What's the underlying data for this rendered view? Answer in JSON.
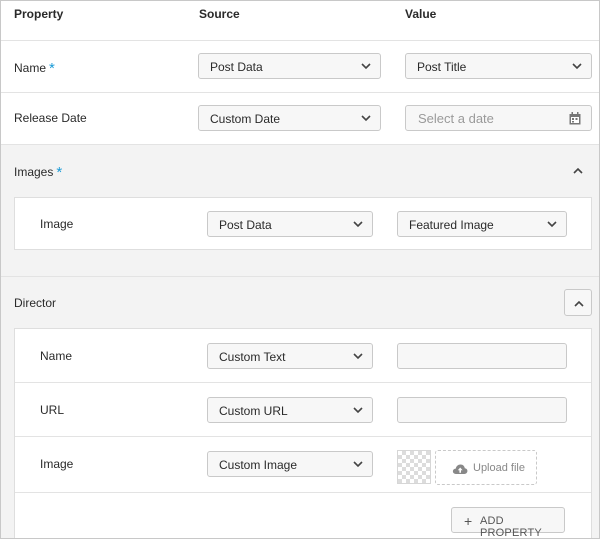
{
  "header": {
    "property": "Property",
    "source": "Source",
    "value": "Value"
  },
  "rows": {
    "name": {
      "label": "Name",
      "required": "*",
      "source": "Post Data",
      "value": "Post Title"
    },
    "release_date": {
      "label": "Release Date",
      "source": "Custom Date",
      "placeholder": "Select a date"
    }
  },
  "images": {
    "label": "Images",
    "required": "*",
    "image": {
      "label": "Image",
      "source": "Post Data",
      "value": "Featured Image"
    }
  },
  "director": {
    "label": "Director",
    "name": {
      "label": "Name",
      "source": "Custom Text",
      "value": ""
    },
    "url": {
      "label": "URL",
      "source": "Custom URL",
      "value": ""
    },
    "image": {
      "label": "Image",
      "source": "Custom Image",
      "upload_label": "Upload file"
    },
    "add_property": "ADD PROPERTY"
  },
  "colors": {
    "required_accent": "#1a9bd7",
    "section_bg": "#f3f3f3",
    "field_bg": "#f7f7f7"
  },
  "icons": [
    "chevron-down-icon",
    "chevron-up-icon",
    "calendar-icon",
    "upload-cloud-icon",
    "plus-icon"
  ]
}
